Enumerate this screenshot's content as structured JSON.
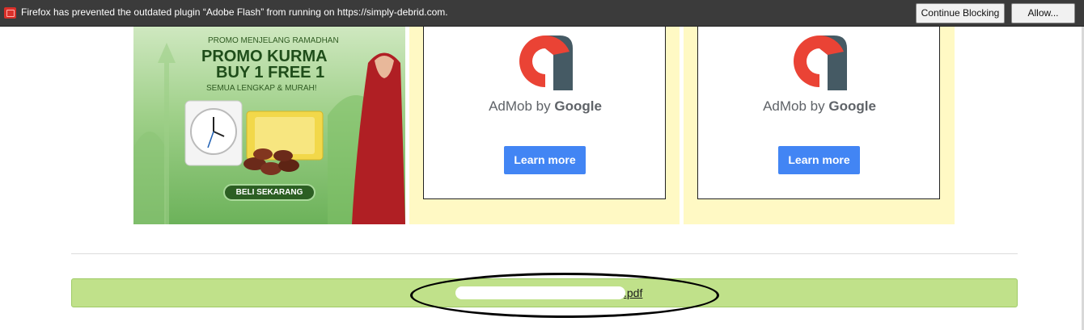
{
  "notification": {
    "message": "Firefox has prevented the outdated plugin “Adobe Flash” from running on https://simply-debrid.com.",
    "continue_blocking_label": "Continue Blocking",
    "allow_label": "Allow...",
    "bar_color": "#3b3b3b"
  },
  "promo_ad": {
    "line1": "PROMO MENJELANG RAMADHAN",
    "line2": "PROMO KURMA",
    "line3": "BUY 1 FREE 1",
    "line4": "SEMUA LENGKAP & MURAH!",
    "cta_label": "BELI SEKARANG"
  },
  "admob_ads": [
    {
      "brand_prefix": "AdMob by ",
      "brand_google": "Google",
      "button_label": "Learn more"
    },
    {
      "brand_prefix": "AdMob by ",
      "brand_google": "Google",
      "button_label": "Learn more"
    }
  ],
  "download": {
    "filename_suffix": ".pdf",
    "bar_color": "#c0e18a"
  },
  "colors": {
    "ad_slot_bg": "#fff9c4",
    "learn_more_blue": "#4285f4",
    "admob_red": "#ea4335",
    "admob_dark": "#455a64"
  }
}
